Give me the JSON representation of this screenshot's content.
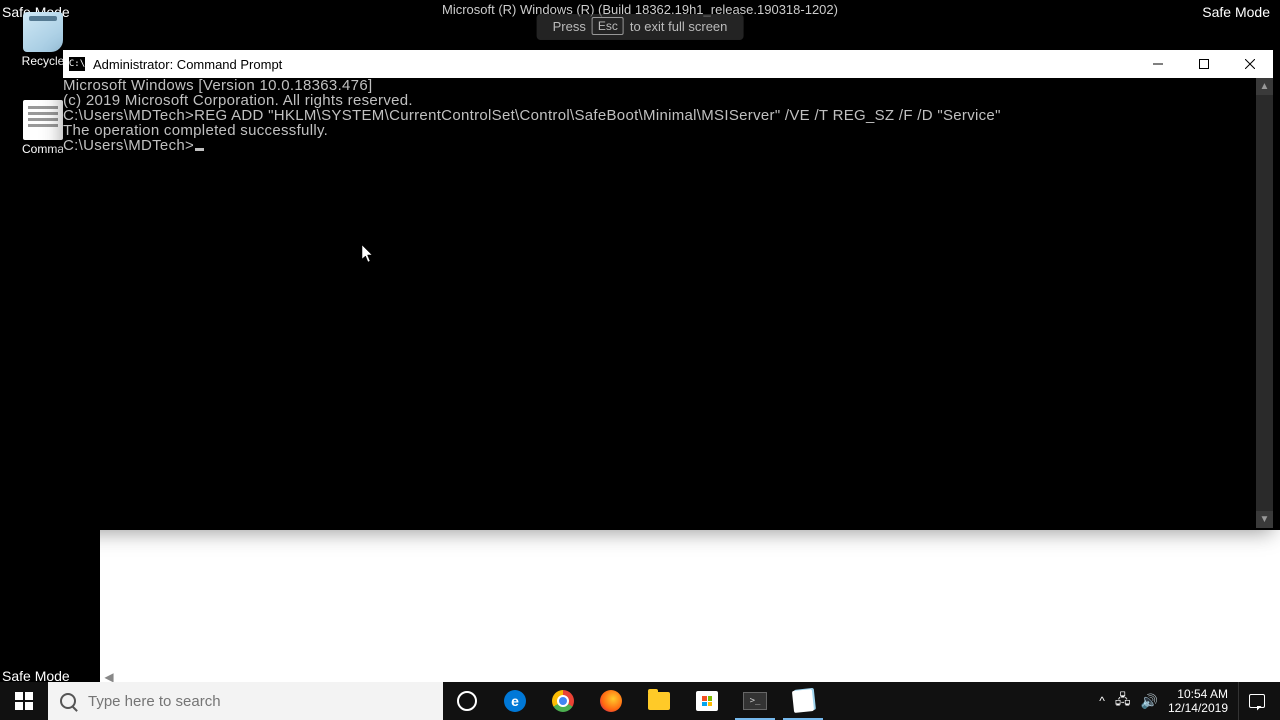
{
  "safe_mode_label": "Safe Mode",
  "build_info": "Microsoft (R) Windows (R) (Build 18362.19h1_release.190318-1202)",
  "esc_overlay": {
    "press": "Press",
    "key": "Esc",
    "rest": "to exit full screen"
  },
  "desktop": {
    "recycle": "Recycle",
    "comma": "Comma"
  },
  "cmd": {
    "title": "Administrator: Command Prompt",
    "lines": {
      "l1": "Microsoft Windows [Version 10.0.18363.476]",
      "l2": "(c) 2019 Microsoft Corporation. All rights reserved.",
      "l3": "",
      "l4": "C:\\Users\\MDTech>REG ADD \"HKLM\\SYSTEM\\CurrentControlSet\\Control\\SafeBoot\\Minimal\\MSIServer\" /VE /T REG_SZ /F /D \"Service\"",
      "l5": "",
      "l6": "The operation completed successfully.",
      "l7": "",
      "l8": "C:\\Users\\MDTech>"
    }
  },
  "taskbar": {
    "search_placeholder": "Type here to search",
    "time": "10:54 AM",
    "date": "12/14/2019"
  }
}
